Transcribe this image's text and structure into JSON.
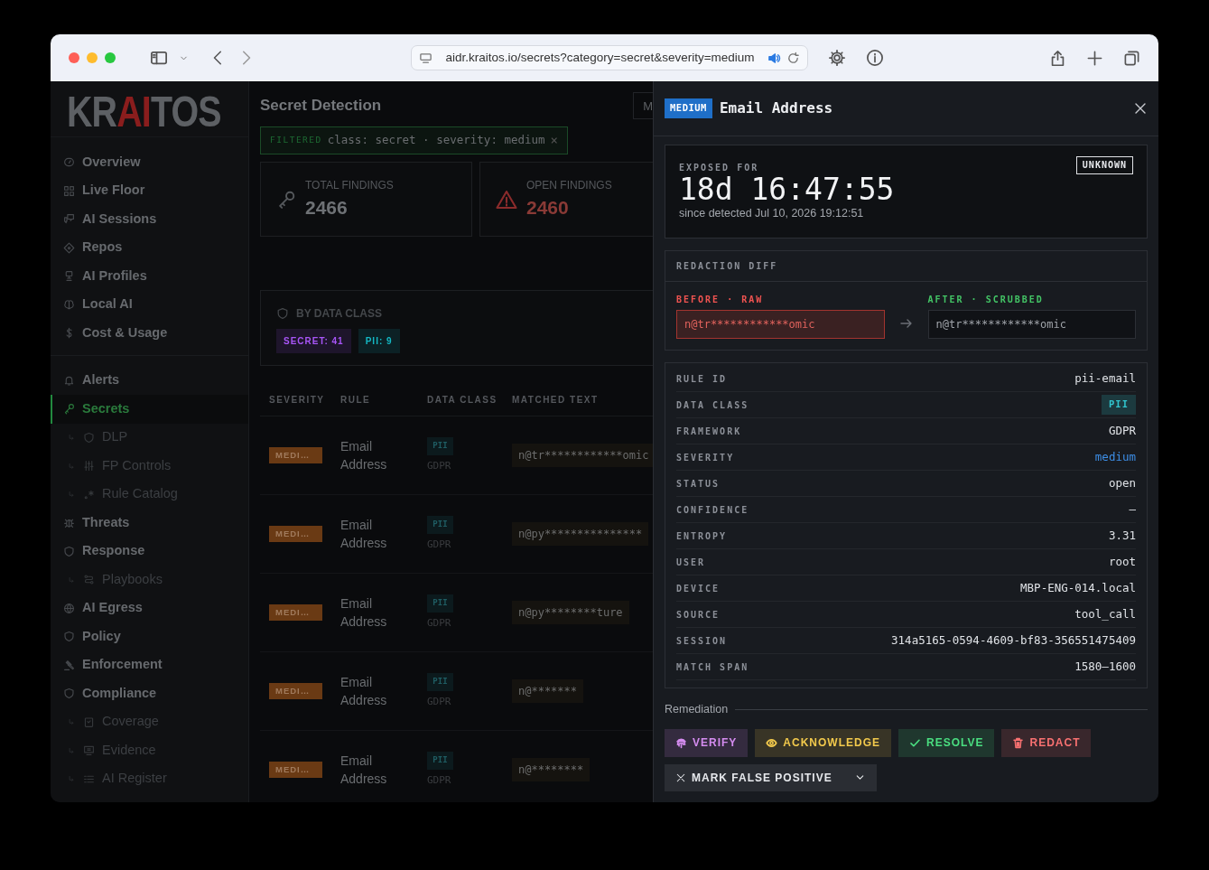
{
  "browser": {
    "url": "aidr.kraitos.io/secrets?category=secret&severity=medium"
  },
  "sidebar": {
    "logo": {
      "before": "KR",
      "accent": "AI",
      "after": "TOS"
    },
    "groups": [
      {
        "items": [
          {
            "label": "Overview",
            "kind": "main",
            "selected": false
          },
          {
            "label": "Live Floor",
            "kind": "main",
            "selected": false
          },
          {
            "label": "AI Sessions",
            "kind": "main",
            "selected": false
          },
          {
            "label": "Repos",
            "kind": "main",
            "selected": false
          },
          {
            "label": "AI Profiles",
            "kind": "main",
            "selected": false
          },
          {
            "label": "Local AI",
            "kind": "main",
            "selected": false
          },
          {
            "label": "Cost & Usage",
            "kind": "main",
            "selected": false
          }
        ]
      },
      {
        "items": [
          {
            "label": "Alerts",
            "kind": "main",
            "selected": false
          },
          {
            "label": "Secrets",
            "kind": "main",
            "selected": true
          },
          {
            "label": "DLP",
            "kind": "sub",
            "selected": false
          },
          {
            "label": "FP Controls",
            "kind": "sub",
            "selected": false
          },
          {
            "label": "Rule Catalog",
            "kind": "sub",
            "selected": false
          },
          {
            "label": "Threats",
            "kind": "main",
            "selected": false
          },
          {
            "label": "Response",
            "kind": "main",
            "selected": false
          },
          {
            "label": "Playbooks",
            "kind": "sub",
            "selected": false
          },
          {
            "label": "AI Egress",
            "kind": "main",
            "selected": false
          },
          {
            "label": "Policy",
            "kind": "main",
            "selected": false
          },
          {
            "label": "Enforcement",
            "kind": "main",
            "selected": false
          },
          {
            "label": "Compliance",
            "kind": "main",
            "selected": false
          },
          {
            "label": "Coverage",
            "kind": "sub",
            "selected": false
          },
          {
            "label": "Evidence",
            "kind": "sub",
            "selected": false
          },
          {
            "label": "AI Register",
            "kind": "sub",
            "selected": false
          }
        ]
      }
    ]
  },
  "main": {
    "title": "Secret Detection",
    "top_button": "M",
    "filter": {
      "tag": "FILTERED",
      "text": "class: secret · severity: medium",
      "clear": "×"
    },
    "stats": [
      {
        "label": "TOTAL FINDINGS",
        "value": "2466",
        "kind": "neutral"
      },
      {
        "label": "OPEN FINDINGS",
        "value": "2460",
        "kind": "danger"
      }
    ],
    "by_class": {
      "title": "BY DATA CLASS",
      "badges": [
        {
          "text": "SECRET: 41",
          "color": "#a855f7"
        },
        {
          "text": "PII: 9",
          "color": "#14b8c4"
        }
      ]
    },
    "table": {
      "columns": [
        "SEVERITY",
        "RULE",
        "DATA CLASS",
        "MATCHED TEXT"
      ],
      "rows": [
        {
          "severity": "MEDI…",
          "rule": "Email Address",
          "data_class": "PII",
          "framework": "GDPR",
          "matched": "n@tr************omic"
        },
        {
          "severity": "MEDI…",
          "rule": "Email Address",
          "data_class": "PII",
          "framework": "GDPR",
          "matched": "n@py***************"
        },
        {
          "severity": "MEDI…",
          "rule": "Email Address",
          "data_class": "PII",
          "framework": "GDPR",
          "matched": "n@py********ture"
        },
        {
          "severity": "MEDI…",
          "rule": "Email Address",
          "data_class": "PII",
          "framework": "GDPR",
          "matched": "n@*******"
        },
        {
          "severity": "MEDI…",
          "rule": "Email Address",
          "data_class": "PII",
          "framework": "GDPR",
          "matched": "n@********"
        }
      ]
    }
  },
  "drawer": {
    "severity": "MEDIUM",
    "title": "Email Address",
    "exposure": {
      "label": "EXPOSED FOR",
      "status": "UNKNOWN",
      "duration": "18d 16:47:55",
      "since": "since detected Jul 10, 2026 19:12:51"
    },
    "diff": {
      "title": "REDACTION DIFF",
      "before_label": "BEFORE · RAW",
      "before": "n@tr************omic",
      "after_label": "AFTER · SCRUBBED",
      "after": "n@tr************omic"
    },
    "details": [
      {
        "label": "RULE ID",
        "value": "pii-email",
        "kind": "text"
      },
      {
        "label": "DATA CLASS",
        "value": "PII",
        "kind": "badge"
      },
      {
        "label": "FRAMEWORK",
        "value": "GDPR",
        "kind": "text"
      },
      {
        "label": "SEVERITY",
        "value": "medium",
        "kind": "accent"
      },
      {
        "label": "STATUS",
        "value": "open",
        "kind": "text"
      },
      {
        "label": "CONFIDENCE",
        "value": "—",
        "kind": "text"
      },
      {
        "label": "ENTROPY",
        "value": "3.31",
        "kind": "text"
      },
      {
        "label": "USER",
        "value": "root",
        "kind": "text"
      },
      {
        "label": "DEVICE",
        "value": "MBP-ENG-014.local",
        "kind": "text"
      },
      {
        "label": "SOURCE",
        "value": "tool_call",
        "kind": "text"
      },
      {
        "label": "SESSION",
        "value": "314a5165-0594-4609-bf83-356551475409",
        "kind": "text"
      },
      {
        "label": "MATCH SPAN",
        "value": "1580–1600",
        "kind": "text"
      }
    ],
    "remediation": {
      "title": "Remediation",
      "actions": [
        {
          "label": "VERIFY",
          "color": "#d58cf0"
        },
        {
          "label": "ACKNOWLEDGE",
          "color": "#f2c94c"
        },
        {
          "label": "RESOLVE",
          "color": "#4ade80"
        },
        {
          "label": "REDACT",
          "color": "#f87171"
        }
      ],
      "dropdown": "MARK FALSE POSITIVE"
    }
  }
}
